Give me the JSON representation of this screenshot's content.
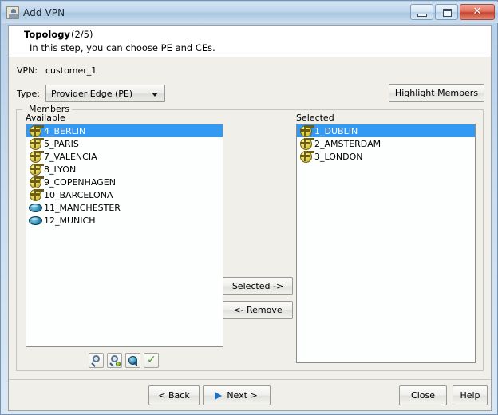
{
  "window": {
    "title": "Add VPN",
    "icon": "app-icon",
    "controls": {
      "minimize": "minimize",
      "maximize": "maximize",
      "close": "✕"
    }
  },
  "header": {
    "title": "Topology",
    "step": "(2/5)",
    "subtitle": "In this step, you can choose PE and CEs."
  },
  "form": {
    "vpn_label": "VPN:",
    "vpn_value": "customer_1",
    "type_label": "Type:",
    "type_value": "Provider Edge (PE)",
    "type_options": [
      "Provider Edge (PE)"
    ],
    "highlight_members_button": "Highlight Members"
  },
  "members": {
    "group_label": "Members",
    "available_label": "Available",
    "selected_label": "Selected",
    "available_items": [
      {
        "label": "4_BERLIN",
        "icon": "pe-router-icon",
        "selected": true
      },
      {
        "label": "5_PARIS",
        "icon": "pe-router-icon",
        "selected": false
      },
      {
        "label": "7_VALENCIA",
        "icon": "pe-router-icon",
        "selected": false
      },
      {
        "label": "8_LYON",
        "icon": "pe-router-icon",
        "selected": false
      },
      {
        "label": "9_COPENHAGEN",
        "icon": "pe-router-icon",
        "selected": false
      },
      {
        "label": "10_BARCELONA",
        "icon": "pe-router-icon",
        "selected": false
      },
      {
        "label": "11_MANCHESTER",
        "icon": "ce-router-icon",
        "selected": false
      },
      {
        "label": "12_MUNICH",
        "icon": "ce-router-icon",
        "selected": false
      }
    ],
    "selected_items": [
      {
        "label": "1_DUBLIN",
        "icon": "pe-router-icon",
        "selected": true
      },
      {
        "label": "2_AMSTERDAM",
        "icon": "pe-router-icon",
        "selected": false
      },
      {
        "label": "3_LONDON",
        "icon": "pe-router-icon",
        "selected": false
      }
    ],
    "add_button": "Selected ->",
    "remove_button": "<- Remove",
    "toolbar_icons": [
      "zoom-icon",
      "zoom-find-icon",
      "globe-navigate-icon",
      "check-icon"
    ]
  },
  "footer": {
    "back_button": "< Back",
    "next_button": "Next >",
    "close_button": "Close",
    "help_button": "Help"
  },
  "colors": {
    "selection_blue": "#3399f3",
    "titlebar_blue": "#bfd5ea",
    "close_red": "#c4422f",
    "panel_gray": "#f0efe9",
    "list_white": "#fdffff"
  }
}
